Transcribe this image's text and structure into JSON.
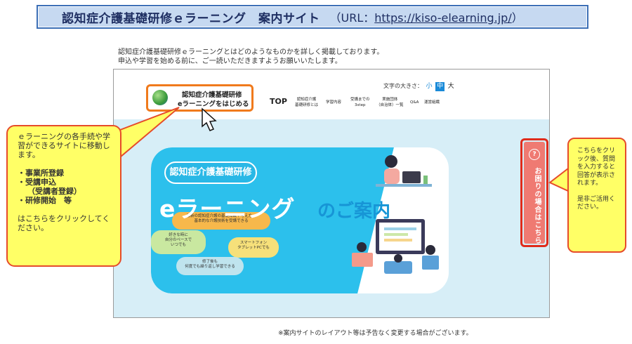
{
  "banner": {
    "title": "認知症介護基礎研修ｅラーニング　案内サイト",
    "url_prefix": "（URL：",
    "url": "https://kiso-elearning.jp/",
    "url_suffix": "）"
  },
  "intro": {
    "line1": "認知症介護基礎研修ｅラーニングとはどのようなものかを詳しく掲載しております。",
    "line2": "申込や学習を始める前に、ご一読いただきますようお願いいたします。"
  },
  "site": {
    "font_size_label": "文字の大きさ：",
    "font_sizes": [
      "小",
      "中",
      "大"
    ],
    "logo": {
      "line1": "認知症介護基礎研修",
      "line2": "eラーニングをはじめる"
    },
    "nav": {
      "top": "TOP",
      "about1": "認知症介護",
      "about2": "基礎研修とは",
      "content": "学習内容",
      "steps1": "受講までの",
      "steps2": "3step",
      "list1": "実施団体",
      "list2": "（自治体）一覧",
      "qa": "Q&A",
      "org": "運営組織"
    },
    "hero": {
      "bubble": "認知症介護基礎研修",
      "headline": "eラーニング",
      "headline2": "のご案内",
      "pill1": {
        "a": "最新の認知症介護の基礎知識や考え方、",
        "b": "基本的な介護技術を受講できる"
      },
      "pill2": {
        "a": "好きな時に",
        "b": "自分のペースで",
        "c": "いつでも"
      },
      "pill3": {
        "a": "スマートフォン",
        "b": "タブレットPCでも"
      },
      "pill4": {
        "a": "修了後も",
        "b": "何度でも繰り返し学習できる"
      }
    },
    "help_tab": "お困りの場合はこちら"
  },
  "callout_left": {
    "p1": "ｅラーニングの各手続や学習ができるサイトに移動します。",
    "items": [
      "・事業所登録",
      "・受講申込",
      "（受講者登録）",
      "・研修開始　等"
    ],
    "p2": "はこちらをクリックしてください。"
  },
  "callout_right": {
    "p1": "こちらをクリック後、質問を入力すると回答が表示されます。",
    "p2": "是非ご活用ください。"
  },
  "note": "※案内サイトのレイアウト等は予告なく変更する場合がございます。",
  "colors": {
    "accent_orange": "#f07a1c",
    "callout_border": "#e64b2a",
    "callout_fill": "#ffff66",
    "hero_blue": "#2cc0ec",
    "banner_fill": "#c6d9f1"
  }
}
